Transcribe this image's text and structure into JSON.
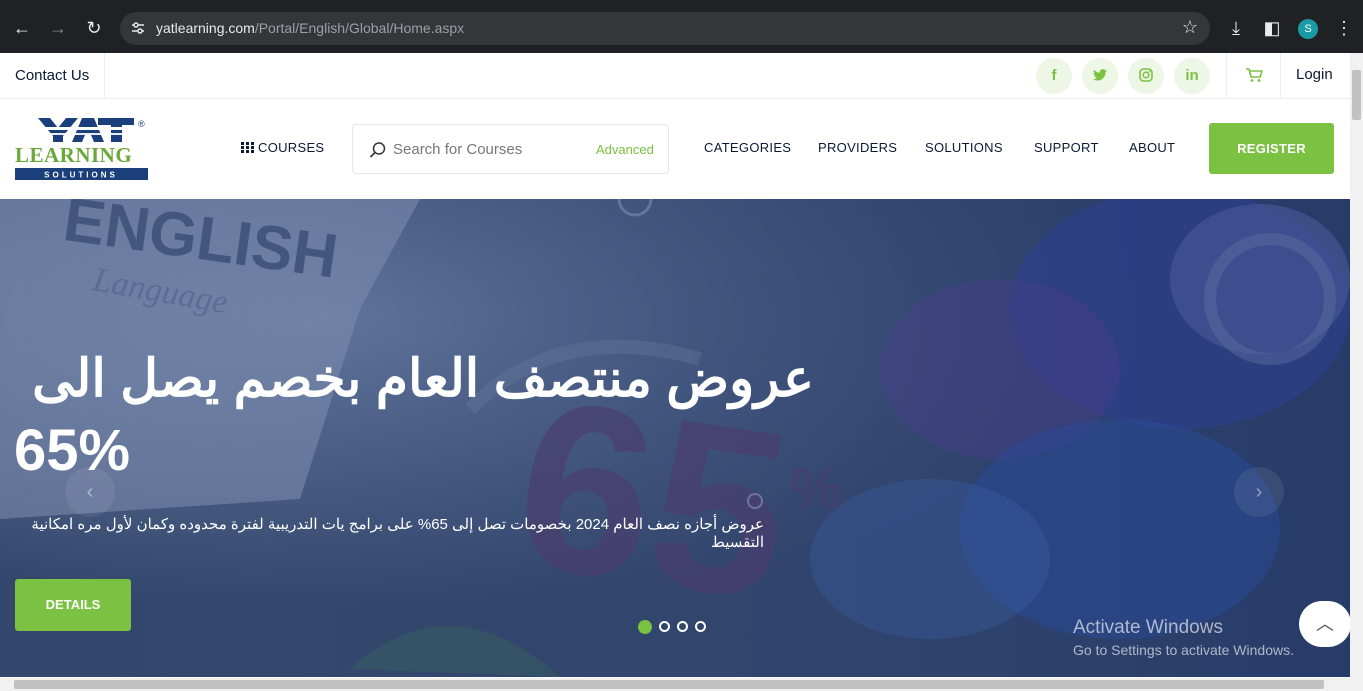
{
  "browser": {
    "url_host": "yatlearning.com",
    "url_path": "/Portal/English/Global/Home.aspx",
    "profile_initial": "S"
  },
  "topbar": {
    "contact": "Contact Us",
    "social": [
      {
        "icon": "facebook-icon",
        "glyph": "f"
      },
      {
        "icon": "twitter-icon",
        "glyph": "t"
      },
      {
        "icon": "instagram-icon",
        "glyph": "◎"
      },
      {
        "icon": "linkedin-icon",
        "glyph": "in"
      }
    ],
    "login": "Login"
  },
  "header": {
    "courses": "COURSES",
    "search_placeholder": "Search for Courses",
    "advanced": "Advanced",
    "nav": [
      "CATEGORIES",
      "PROVIDERS",
      "SOLUTIONS",
      "SUPPORT",
      "ABOUT"
    ],
    "register": "REGISTER"
  },
  "hero": {
    "title_line1": "عروض منتصف العام بخصم يصل الى",
    "title_line2": "65%",
    "subtitle": "عروض أجازه نصف العام 2024 بخصومات تصل إلى 65% على برامج يات التدريبية لفترة محدوده وكمان لأول مره امكانية التقسيط",
    "details": "DETAILS",
    "slide_count": 4,
    "active_slide": 1
  },
  "watermark": {
    "line1": "Activate Windows",
    "line2": "Go to Settings to activate Windows."
  },
  "colors": {
    "accent": "#7bc142",
    "navy": "#0b1a33",
    "hero_overlay": "#33466b"
  }
}
